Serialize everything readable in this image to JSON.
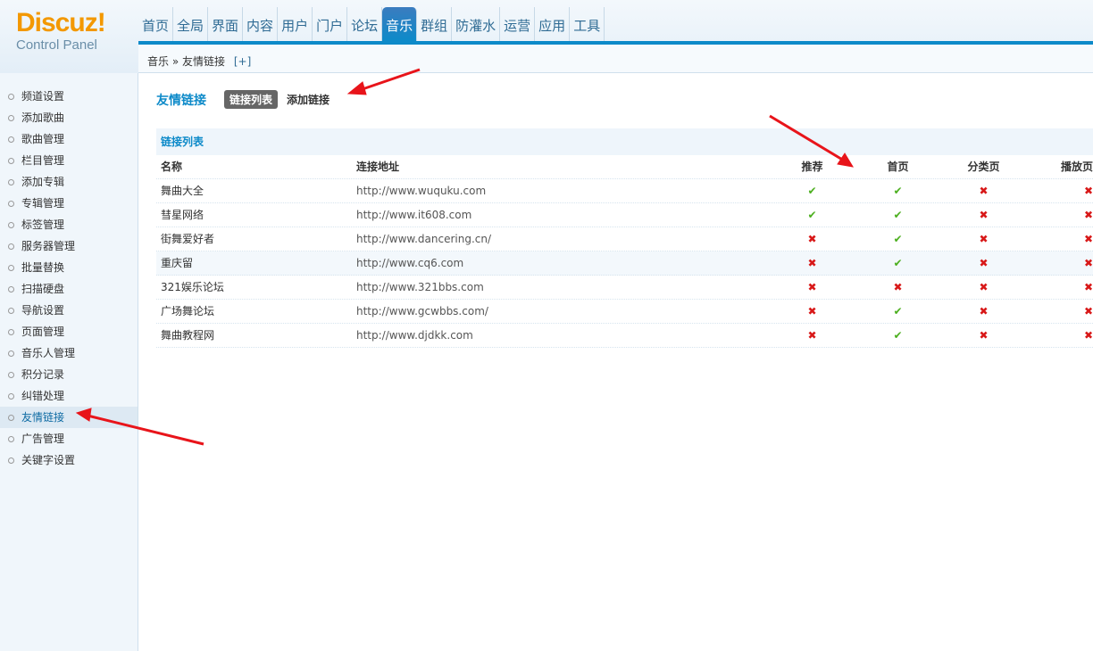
{
  "logo": {
    "brand": "Discuz!",
    "sub": "Control Panel"
  },
  "nav": [
    "首页",
    "全局",
    "界面",
    "内容",
    "用户",
    "门户",
    "论坛",
    "音乐",
    "群组",
    "防灌水",
    "运营",
    "应用",
    "工具"
  ],
  "nav_active": 7,
  "breadcrumb": {
    "parent": "音乐",
    "sep": "»",
    "current": "友情链接",
    "plus": "[+]"
  },
  "sidebar": {
    "items": [
      "频道设置",
      "添加歌曲",
      "歌曲管理",
      "栏目管理",
      "添加专辑",
      "专辑管理",
      "标签管理",
      "服务器管理",
      "批量替换",
      "扫描硬盘",
      "导航设置",
      "页面管理",
      "音乐人管理",
      "积分记录",
      "纠错处理",
      "友情链接",
      "广告管理",
      "关键字设置"
    ],
    "active": 15
  },
  "page": {
    "title": "友情链接",
    "tabs": [
      "链接列表",
      "添加链接"
    ]
  },
  "table": {
    "section": "链接列表",
    "headers": [
      "名称",
      "连接地址",
      "推荐",
      "首页",
      "分类页",
      "播放页"
    ],
    "rows": [
      {
        "name": "舞曲大全",
        "url": "http://www.wuquku.com",
        "flags": [
          true,
          true,
          false,
          false
        ]
      },
      {
        "name": "彗星网络",
        "url": "http://www.it608.com",
        "flags": [
          true,
          true,
          false,
          false
        ]
      },
      {
        "name": "街舞爱好者",
        "url": "http://www.dancering.cn/",
        "flags": [
          false,
          true,
          false,
          false
        ]
      },
      {
        "name": "重庆留",
        "url": "http://www.cq6.com",
        "flags": [
          false,
          true,
          false,
          false
        ]
      },
      {
        "name": "321娱乐论坛",
        "url": "http://www.321bbs.com",
        "flags": [
          false,
          false,
          false,
          false
        ]
      },
      {
        "name": "广场舞论坛",
        "url": "http://www.gcwbbs.com/",
        "flags": [
          false,
          true,
          false,
          false
        ]
      },
      {
        "name": "舞曲教程网",
        "url": "http://www.djdkk.com",
        "flags": [
          false,
          true,
          false,
          false
        ]
      }
    ]
  },
  "icons": {
    "yes": "check-icon",
    "no": "cross-icon"
  },
  "colors": {
    "accent": "#0d8ac9",
    "brand": "#f39800",
    "check": "#4caf1f",
    "cross": "#d81818"
  }
}
